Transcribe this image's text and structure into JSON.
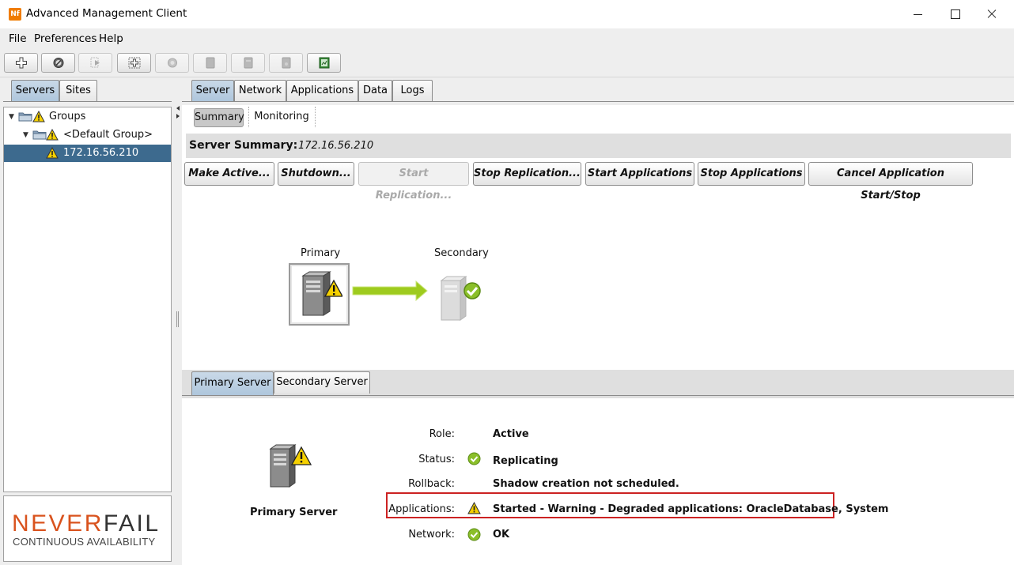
{
  "window": {
    "title": "Advanced Management Client",
    "app_icon_text": "Nf"
  },
  "menu": {
    "items": [
      "File",
      "Preferences",
      "Help"
    ]
  },
  "left_tabs": [
    "Servers",
    "Sites"
  ],
  "tree": {
    "root": "Groups",
    "group": "<Default Group>",
    "server": "172.16.56.210"
  },
  "logo": {
    "brand_never": "NEVER",
    "brand_fail": "FAIL",
    "tagline": "CONTINUOUS AVAILABILITY"
  },
  "main_tabs": [
    "Server",
    "Network",
    "Applications",
    "Data",
    "Logs"
  ],
  "sub_tabs": [
    "Summary",
    "Monitoring"
  ],
  "summary": {
    "title": "Server Summary:",
    "host": "172.16.56.210"
  },
  "actions": {
    "make_active": "Make Active...",
    "shutdown": "Shutdown...",
    "start_replication": "Start Replication...",
    "stop_replication": "Stop Replication...",
    "start_applications": "Start Applications",
    "stop_applications": "Stop Applications",
    "cancel_start_stop": "Cancel Application Start/Stop"
  },
  "diagram": {
    "primary_label": "Primary",
    "secondary_label": "Secondary"
  },
  "server_tabs": [
    "Primary Server",
    "Secondary Server"
  ],
  "details": {
    "caption": "Primary Server",
    "role_label": "Role:",
    "role_value": "Active",
    "status_label": "Status:",
    "status_value": "Replicating",
    "rollback_label": "Rollback:",
    "rollback_value": "Shadow creation not scheduled.",
    "applications_label": "Applications:",
    "applications_value": "Started - Warning - Degraded applications: OracleDatabase, System",
    "network_label": "Network:",
    "network_value": "OK"
  },
  "colors": {
    "selection": "#3d6a8e",
    "warning": "#f5d000",
    "ok": "#7fb020",
    "highlight_border": "#cc2222",
    "brand_orange": "#d9531e"
  }
}
